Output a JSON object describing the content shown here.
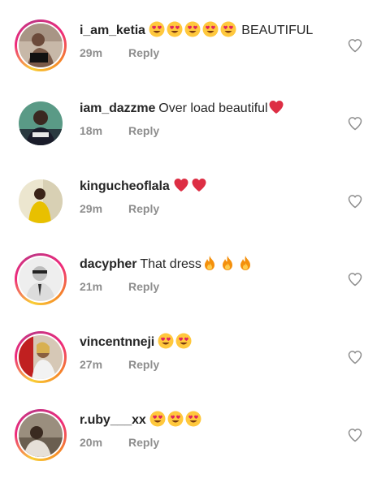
{
  "comments": [
    {
      "username": "i_am_ketia",
      "emojis": [
        "heart-eyes",
        "heart-eyes",
        "heart-eyes",
        "heart-eyes",
        "heart-eyes"
      ],
      "text": " BEAUTIFUL",
      "time": "29m",
      "reply_label": "Reply",
      "story_ring": true,
      "avatar_colors": [
        "#b9a89a",
        "#6b4a3a"
      ]
    },
    {
      "username": "iam_dazzme",
      "text": "Over load beautiful",
      "emojis_after": [
        "red-heart"
      ],
      "time": "18m",
      "reply_label": "Reply",
      "story_ring": false,
      "avatar_colors": [
        "#4f8c7c",
        "#1a2c33"
      ]
    },
    {
      "username": "kingucheoflala",
      "emojis": [
        "red-heart",
        "red-heart"
      ],
      "text": "",
      "time": "29m",
      "reply_label": "Reply",
      "story_ring": false,
      "avatar_colors": [
        "#e8e2c8",
        "#e0b800"
      ]
    },
    {
      "username": "dacypher",
      "text": "That dress",
      "emojis_after": [
        "fire",
        "fire",
        "fire"
      ],
      "time": "21m",
      "reply_label": "Reply",
      "story_ring": true,
      "avatar_colors": [
        "#e6e6e6",
        "#555555"
      ]
    },
    {
      "username": "vincentnneji",
      "emojis": [
        "heart-eyes",
        "heart-eyes"
      ],
      "text": "",
      "time": "27m",
      "reply_label": "Reply",
      "story_ring": true,
      "avatar_colors": [
        "#c9b9a8",
        "#8a6a4a"
      ]
    },
    {
      "username": "r.uby___xx",
      "emojis": [
        "heart-eyes",
        "heart-eyes",
        "heart-eyes"
      ],
      "text": "",
      "time": "20m",
      "reply_label": "Reply",
      "story_ring": true,
      "avatar_colors": [
        "#8a7f70",
        "#3a3028"
      ]
    }
  ],
  "colors": {
    "username": "#262626",
    "meta": "#8e8e8e",
    "like_outline": "#8e8e8e"
  }
}
